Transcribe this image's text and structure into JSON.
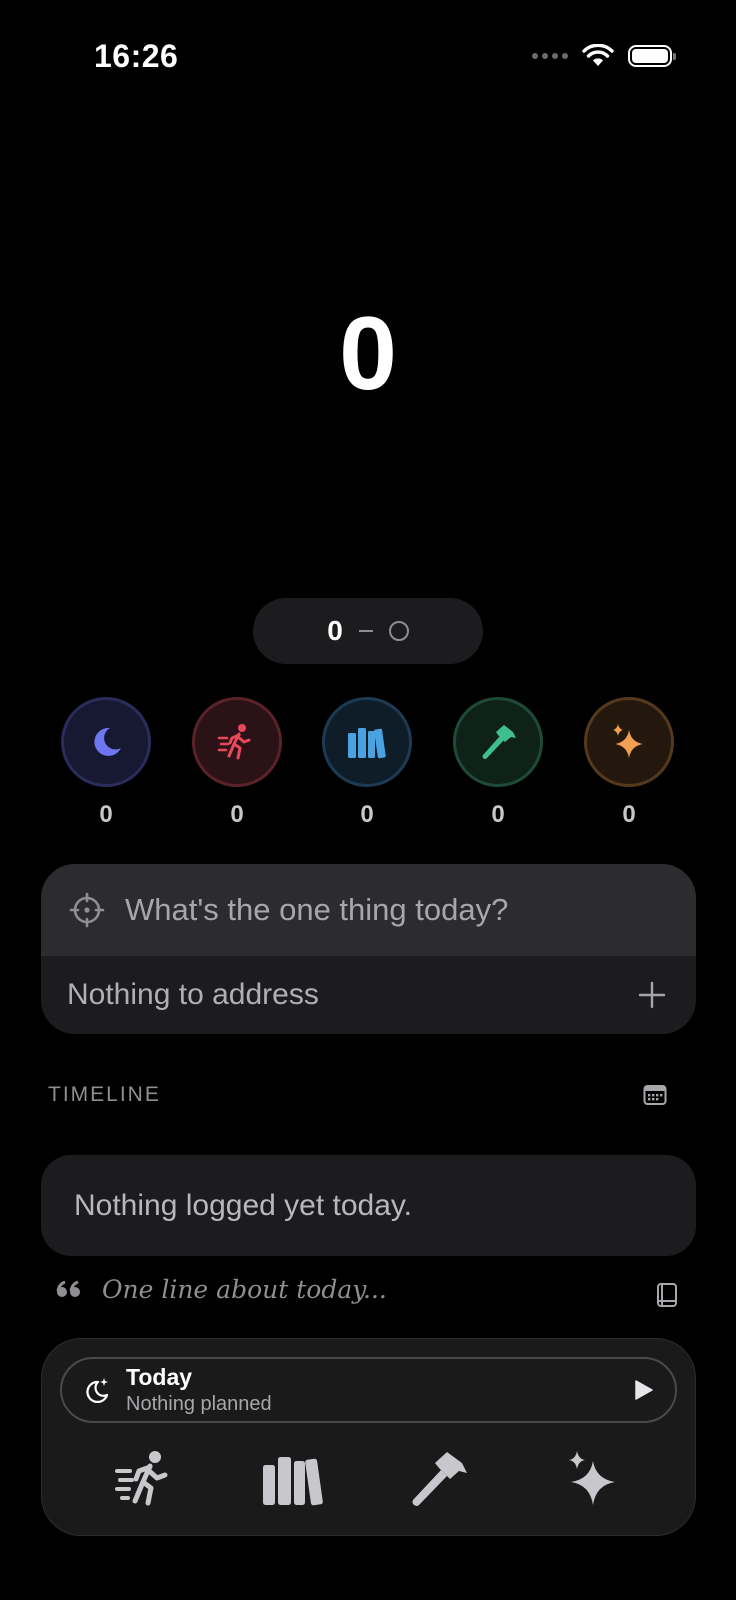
{
  "status_bar": {
    "time": "16:26"
  },
  "main_count": "0",
  "range": {
    "start": "0"
  },
  "categories": [
    {
      "id": "sleep",
      "icon": "moon-icon",
      "count": "0",
      "color": "#6e76f0"
    },
    {
      "id": "move",
      "icon": "running-person-icon",
      "count": "0",
      "color": "#e8485a"
    },
    {
      "id": "read",
      "icon": "books-icon",
      "count": "0",
      "color": "#4aa3e0"
    },
    {
      "id": "build",
      "icon": "hammer-icon",
      "count": "0",
      "color": "#3fbf8f"
    },
    {
      "id": "create",
      "icon": "sparkles-icon",
      "count": "0",
      "color": "#f0a050"
    }
  ],
  "focus": {
    "placeholder": "What's the one thing today?",
    "address_text": "Nothing to address"
  },
  "timeline": {
    "heading": "TIMELINE",
    "empty_text": "Nothing logged yet today."
  },
  "journal": {
    "placeholder": "One line about today..."
  },
  "plan": {
    "title": "Today",
    "subtitle": "Nothing planned"
  },
  "dock_actions": [
    "running-person-icon",
    "books-icon",
    "hammer-icon",
    "sparkles-icon"
  ]
}
